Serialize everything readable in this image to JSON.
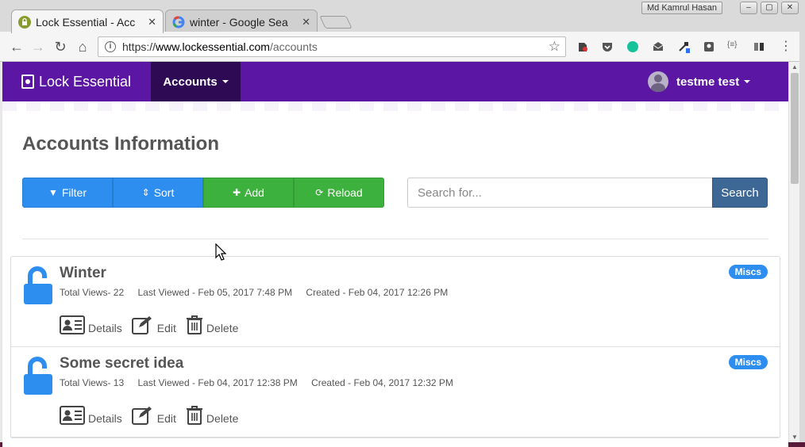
{
  "browser": {
    "tabs": [
      {
        "title": "Lock Essential - Acc",
        "active": true
      },
      {
        "title": "winter - Google Sea",
        "active": false
      }
    ],
    "tab_close": "✕",
    "profile_name": "Md Kamrul Hasan",
    "window_buttons": {
      "minimize": "–",
      "maximize": "▢",
      "close": "✕"
    },
    "nav": {
      "back": "←",
      "forward": "→",
      "reload": "↻",
      "home": "⌂"
    },
    "url_scheme": "https://",
    "url_host": "www.lockessential.com",
    "url_path": "/accounts",
    "bookmark_star": "☆",
    "menu": "⋮"
  },
  "app": {
    "brand": "Lock Essential",
    "nav_accounts": "Accounts",
    "user_name": "testme test",
    "page_title": "Accounts Information",
    "buttons": {
      "filter": "Filter",
      "sort": "Sort",
      "add": "Add",
      "reload": "Reload"
    },
    "button_icons": {
      "filter": "▼",
      "sort": "⇕",
      "add": "✚",
      "reload": "⟳"
    },
    "search": {
      "placeholder": "Search for...",
      "button": "Search"
    },
    "accounts": [
      {
        "title": "Winter",
        "views": "Total Views- 22",
        "last_viewed": "Last Viewed - Feb 05, 2017 7:48 PM",
        "created": "Created - Feb 04, 2017 12:26 PM",
        "category": "Miscs"
      },
      {
        "title": "Some secret idea",
        "views": "Total Views- 13",
        "last_viewed": "Last Viewed - Feb 04, 2017 12:38 PM",
        "created": "Created - Feb 04, 2017 12:32 PM",
        "category": "Miscs"
      }
    ],
    "actions": {
      "details": "Details",
      "edit": "Edit",
      "delete": "Delete"
    }
  },
  "colors": {
    "navbar": "#5b17a3",
    "navbar_active": "#2e0a55",
    "primary_blue": "#2d8ef0",
    "success_green": "#3db13d",
    "search_button": "#3d6896",
    "lock_icon": "#2d8ef0"
  }
}
